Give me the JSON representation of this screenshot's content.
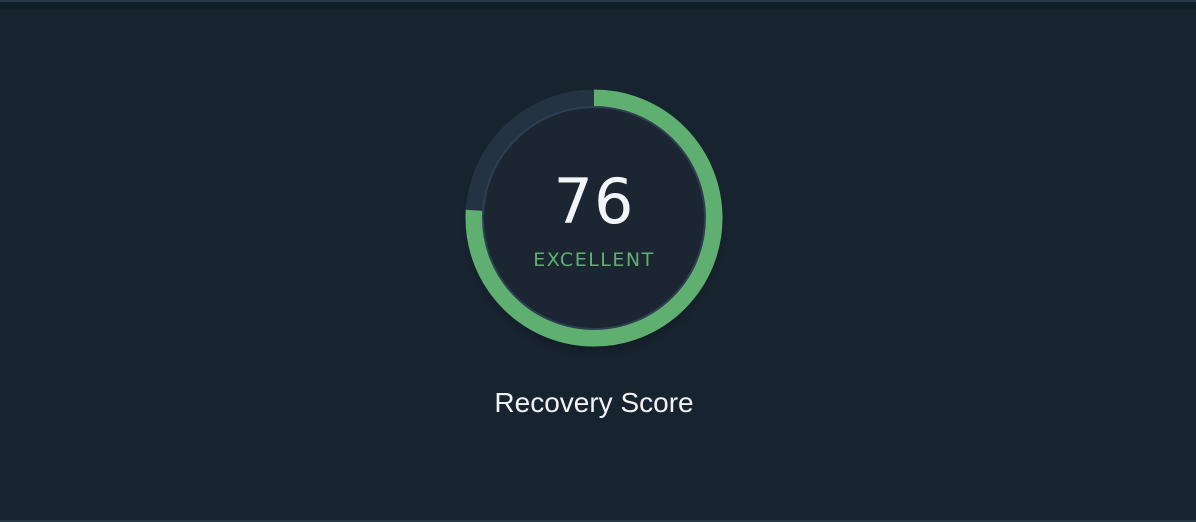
{
  "recovery": {
    "score": "76",
    "rating": "EXCELLENT",
    "title": "Recovery Score",
    "progress_fraction": 0.76
  },
  "colors": {
    "background": "#17232f",
    "track": "#243241",
    "progress": "#5fb070",
    "score_text": "#f2f5f8",
    "rating_text": "#5fb070",
    "title_text": "#f0f3f6"
  }
}
